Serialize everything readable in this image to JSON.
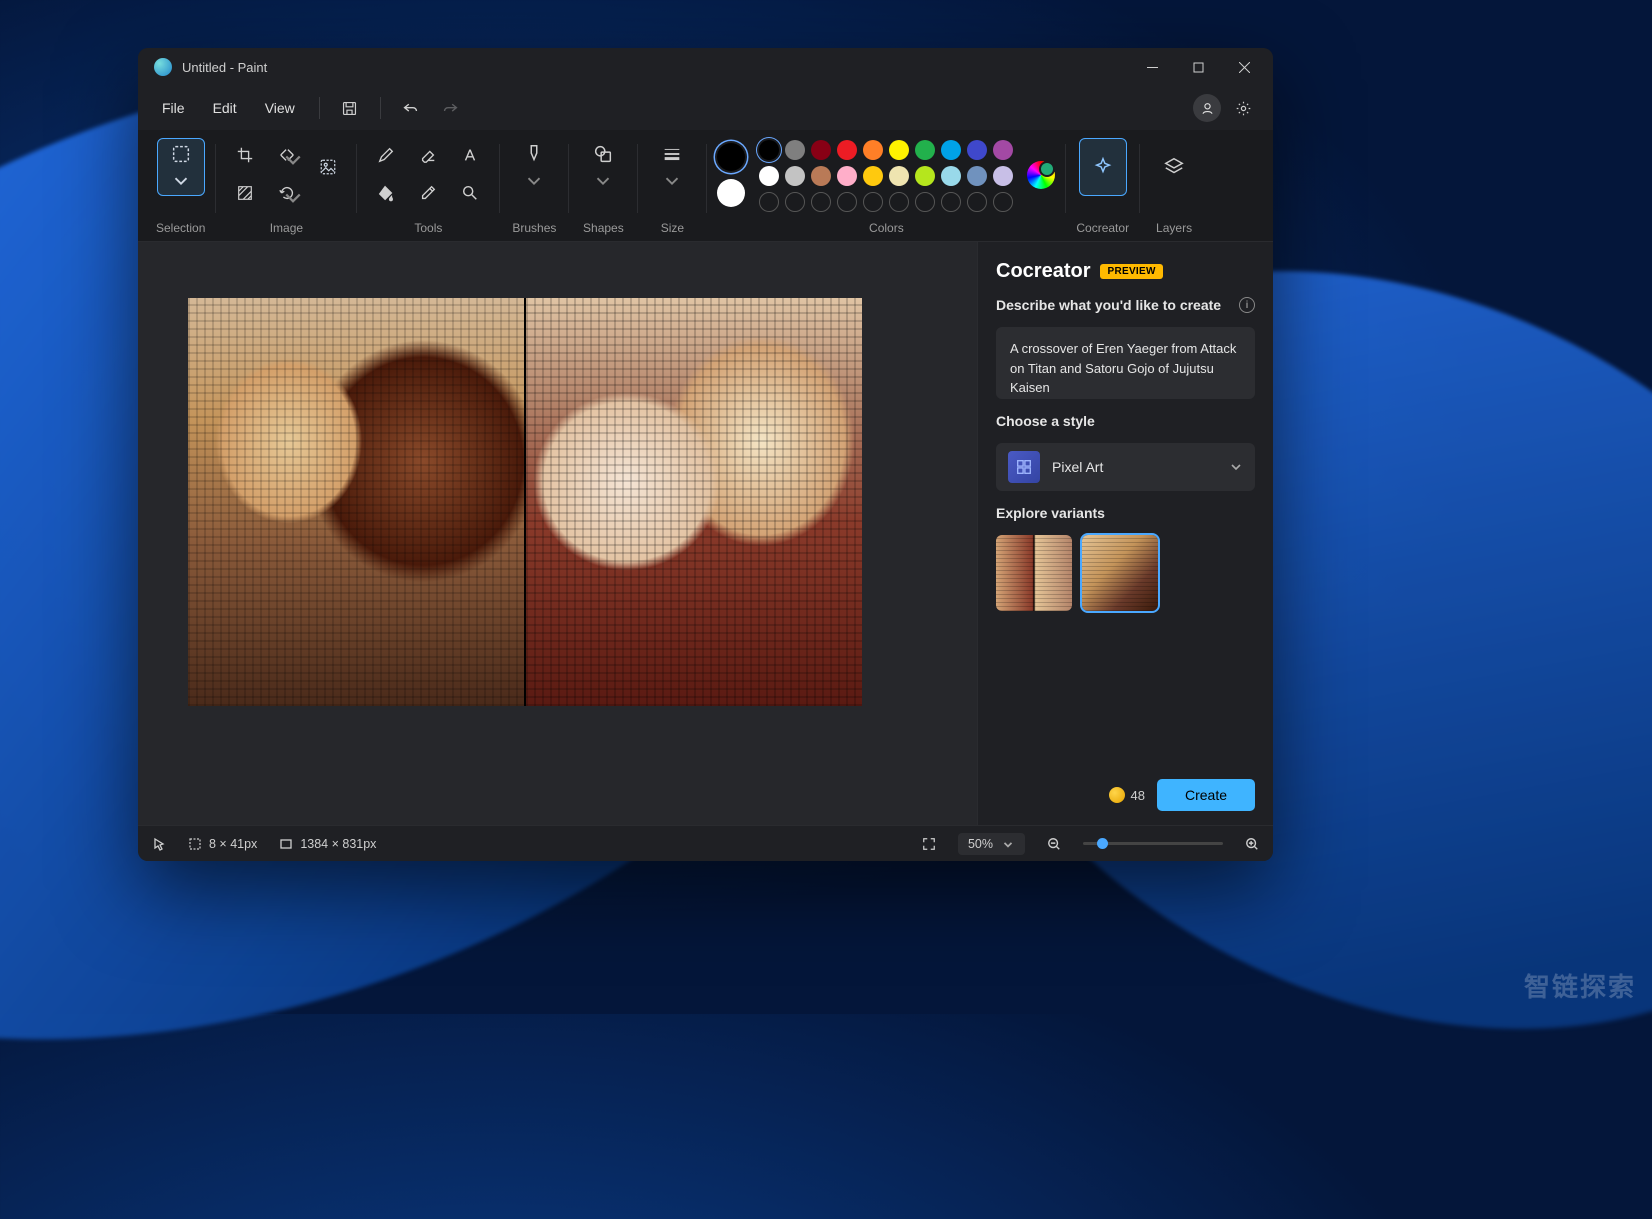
{
  "window_title": "Untitled - Paint",
  "menu": {
    "file": "File",
    "edit": "Edit",
    "view": "View"
  },
  "ribbon": {
    "selection": "Selection",
    "image": "Image",
    "tools": "Tools",
    "brushes": "Brushes",
    "shapes": "Shapes",
    "size": "Size",
    "colors": "Colors",
    "cocreator": "Cocreator",
    "layers": "Layers"
  },
  "colors": {
    "primary": "#000000",
    "secondary": "#ffffff",
    "row1": [
      "#000000",
      "#7f7f7f",
      "#880015",
      "#ed1c24",
      "#ff7f27",
      "#fff200",
      "#22b14c",
      "#00a2e8",
      "#3f48cc",
      "#a349a4"
    ],
    "row2": [
      "#ffffff",
      "#c3c3c3",
      "#b97a57",
      "#ffaec9",
      "#ffc90e",
      "#efe4b0",
      "#b5e61d",
      "#99d9ea",
      "#7092be",
      "#c8bfe7"
    ]
  },
  "cocreator": {
    "title": "Cocreator",
    "badge": "PREVIEW",
    "describe_label": "Describe what you'd like to create",
    "prompt": "A crossover of Eren Yaeger from Attack on Titan and Satoru Gojo of Jujutsu Kaisen",
    "style_label": "Choose a style",
    "style_name": "Pixel Art",
    "variants_label": "Explore variants",
    "credits": "48",
    "create": "Create"
  },
  "statusbar": {
    "cursor_pos": "8 × 41px",
    "canvas_size": "1384 × 831px",
    "zoom": "50%"
  },
  "watermark": "智链探索"
}
